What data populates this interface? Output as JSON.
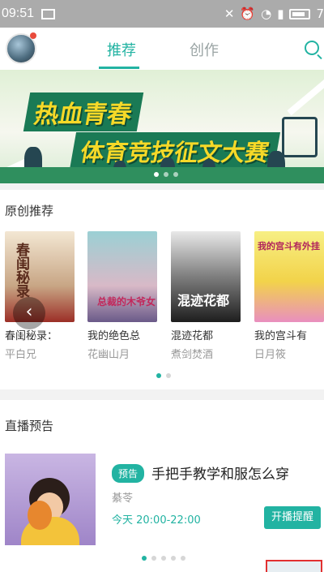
{
  "status_bar": {
    "time": "09:51",
    "battery": "7"
  },
  "nav": {
    "tabs": [
      {
        "label": "推荐",
        "active": true
      },
      {
        "label": "创作",
        "active": false
      }
    ]
  },
  "banner": {
    "line1": "热血青春",
    "line2": "体育竞技征文大赛",
    "dot_count": 3,
    "active_dot": 1
  },
  "original": {
    "title": "原创推荐",
    "books": [
      {
        "name": "春闺秘录：",
        "author": "平白兄",
        "cover_text": "春闺秘录"
      },
      {
        "name": "我的绝色总",
        "author": "花幽山月",
        "cover_text": "总裁的木爷女"
      },
      {
        "name": "混迹花都",
        "author": "煮剑焚酒",
        "cover_text": "混迹花都"
      },
      {
        "name": "我的宫斗有",
        "author": "日月筱",
        "cover_text": "我的宫斗有外挂"
      }
    ],
    "dot_count": 2,
    "active_dot": 0
  },
  "live": {
    "title": "直播预告",
    "badge": "预告",
    "item_title": "手把手教学和服怎么穿",
    "host": "綦苓",
    "time": "今天 20:00-22:00",
    "remind_label": "开播提醒",
    "dot_count": 5,
    "active_dot": 0
  },
  "colors": {
    "accent": "#22b3a2",
    "banner_text": "#f6d928"
  }
}
